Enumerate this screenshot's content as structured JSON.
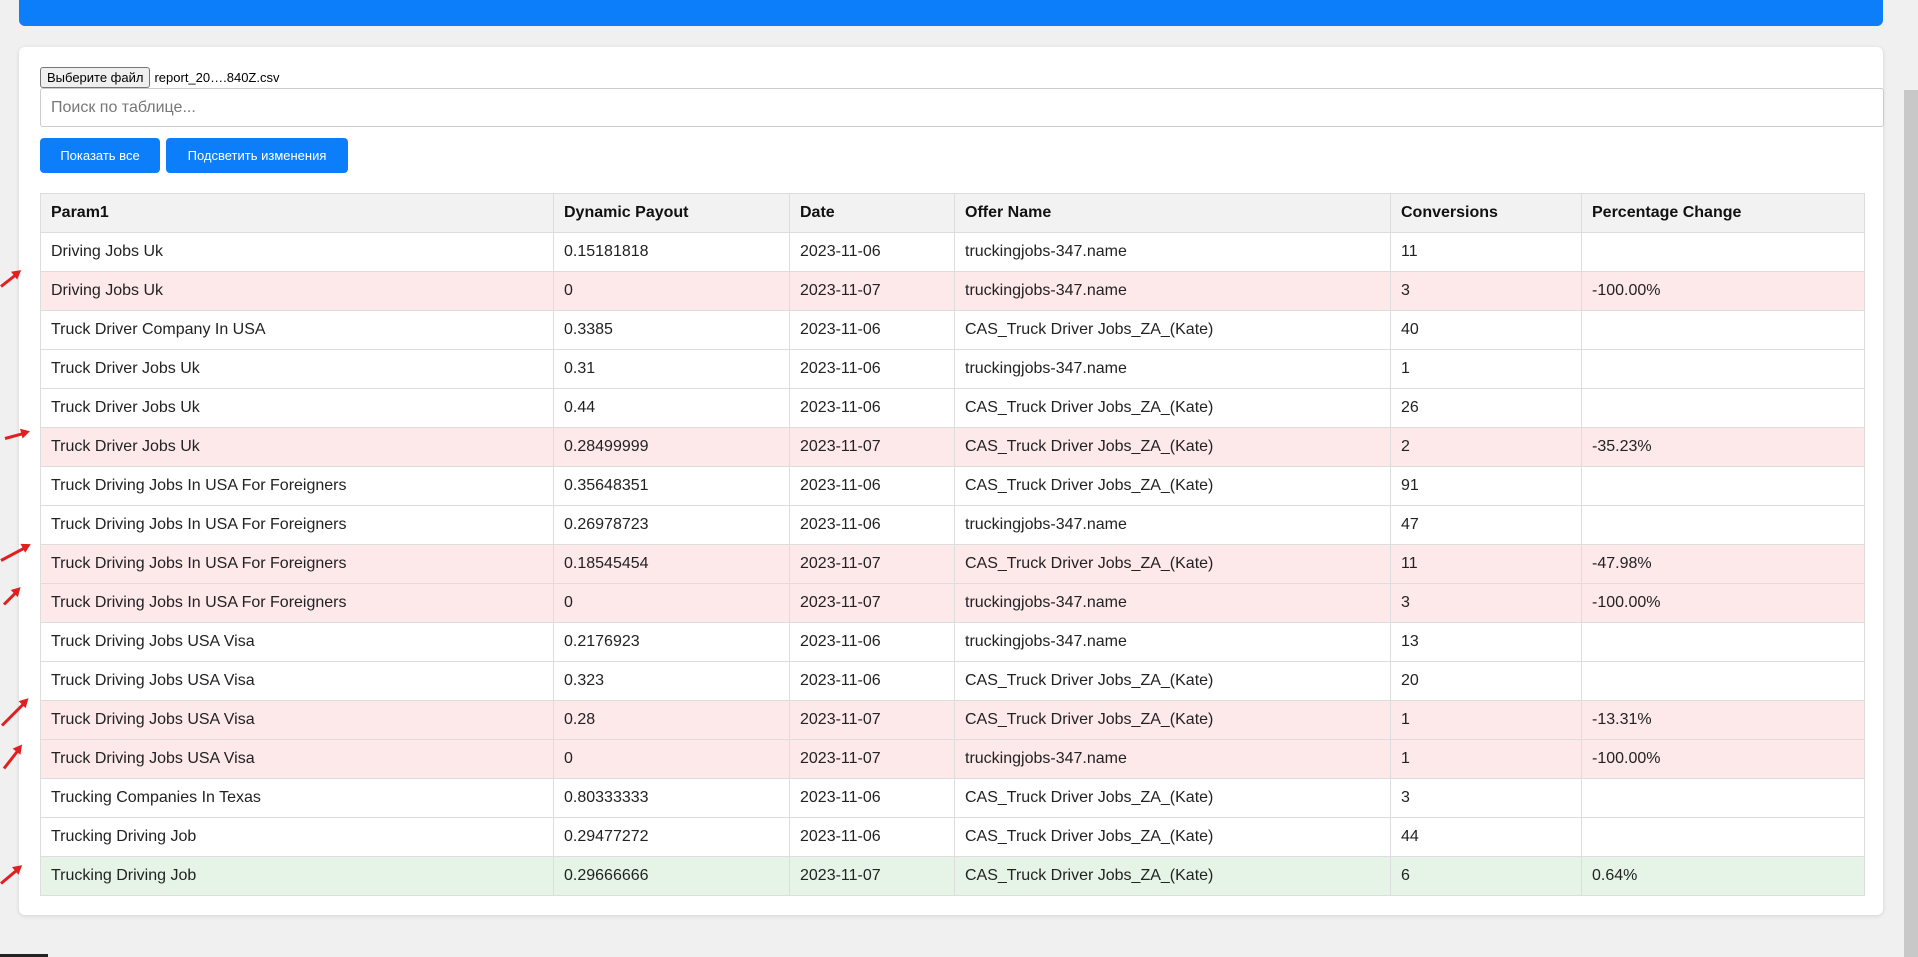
{
  "file": {
    "button_label": "Выберите файл",
    "file_name": "report_20….840Z.csv"
  },
  "search": {
    "placeholder": "Поиск по таблице..."
  },
  "buttons": {
    "show_all": "Показать все",
    "highlight": "Подсветить изменения"
  },
  "table": {
    "headers": [
      "Param1",
      "Dynamic Payout",
      "Date",
      "Offer Name",
      "Conversions",
      "Percentage Change"
    ],
    "rows": [
      {
        "status": "normal",
        "cells": [
          "Driving Jobs Uk",
          "0.15181818",
          "2023-11-06",
          "truckingjobs-347.name",
          "11",
          ""
        ]
      },
      {
        "status": "negative",
        "cells": [
          "Driving Jobs Uk",
          "0",
          "2023-11-07",
          "truckingjobs-347.name",
          "3",
          "-100.00%"
        ]
      },
      {
        "status": "normal",
        "cells": [
          "Truck Driver Company In USA",
          "0.3385",
          "2023-11-06",
          "CAS_Truck Driver Jobs_ZA_(Kate)",
          "40",
          ""
        ]
      },
      {
        "status": "normal",
        "cells": [
          "Truck Driver Jobs Uk",
          "0.31",
          "2023-11-06",
          "truckingjobs-347.name",
          "1",
          ""
        ]
      },
      {
        "status": "normal",
        "cells": [
          "Truck Driver Jobs Uk",
          "0.44",
          "2023-11-06",
          "CAS_Truck Driver Jobs_ZA_(Kate)",
          "26",
          ""
        ]
      },
      {
        "status": "negative",
        "cells": [
          "Truck Driver Jobs Uk",
          "0.28499999",
          "2023-11-07",
          "CAS_Truck Driver Jobs_ZA_(Kate)",
          "2",
          "-35.23%"
        ]
      },
      {
        "status": "normal",
        "cells": [
          "Truck Driving Jobs In USA For Foreigners",
          "0.35648351",
          "2023-11-06",
          "CAS_Truck Driver Jobs_ZA_(Kate)",
          "91",
          ""
        ]
      },
      {
        "status": "normal",
        "cells": [
          "Truck Driving Jobs In USA For Foreigners",
          "0.26978723",
          "2023-11-06",
          "truckingjobs-347.name",
          "47",
          ""
        ]
      },
      {
        "status": "negative",
        "cells": [
          "Truck Driving Jobs In USA For Foreigners",
          "0.18545454",
          "2023-11-07",
          "CAS_Truck Driver Jobs_ZA_(Kate)",
          "11",
          "-47.98%"
        ]
      },
      {
        "status": "negative",
        "cells": [
          "Truck Driving Jobs In USA For Foreigners",
          "0",
          "2023-11-07",
          "truckingjobs-347.name",
          "3",
          "-100.00%"
        ]
      },
      {
        "status": "normal",
        "cells": [
          "Truck Driving Jobs USA Visa",
          "0.2176923",
          "2023-11-06",
          "truckingjobs-347.name",
          "13",
          ""
        ]
      },
      {
        "status": "normal",
        "cells": [
          "Truck Driving Jobs USA Visa",
          "0.323",
          "2023-11-06",
          "CAS_Truck Driver Jobs_ZA_(Kate)",
          "20",
          ""
        ]
      },
      {
        "status": "negative",
        "cells": [
          "Truck Driving Jobs USA Visa",
          "0.28",
          "2023-11-07",
          "CAS_Truck Driver Jobs_ZA_(Kate)",
          "1",
          "-13.31%"
        ]
      },
      {
        "status": "negative",
        "cells": [
          "Truck Driving Jobs USA Visa",
          "0",
          "2023-11-07",
          "truckingjobs-347.name",
          "1",
          "-100.00%"
        ]
      },
      {
        "status": "normal",
        "cells": [
          "Trucking Companies In Texas",
          "0.80333333",
          "2023-11-06",
          "CAS_Truck Driver Jobs_ZA_(Kate)",
          "3",
          ""
        ]
      },
      {
        "status": "normal",
        "cells": [
          "Trucking Driving Job",
          "0.29477272",
          "2023-11-06",
          "CAS_Truck Driver Jobs_ZA_(Kate)",
          "44",
          ""
        ]
      },
      {
        "status": "positive",
        "cells": [
          "Trucking Driving Job",
          "0.29666666",
          "2023-11-07",
          "CAS_Truck Driver Jobs_ZA_(Kate)",
          "6",
          "0.64%"
        ]
      }
    ]
  },
  "annotations": {
    "arrow_color": "#e02020",
    "marked_rows": [
      1,
      5,
      8,
      9,
      12,
      13,
      16
    ]
  },
  "colors": {
    "accent": "#0d7efa",
    "negative_row": "#fde8ea",
    "positive_row": "#e6f4e8"
  }
}
